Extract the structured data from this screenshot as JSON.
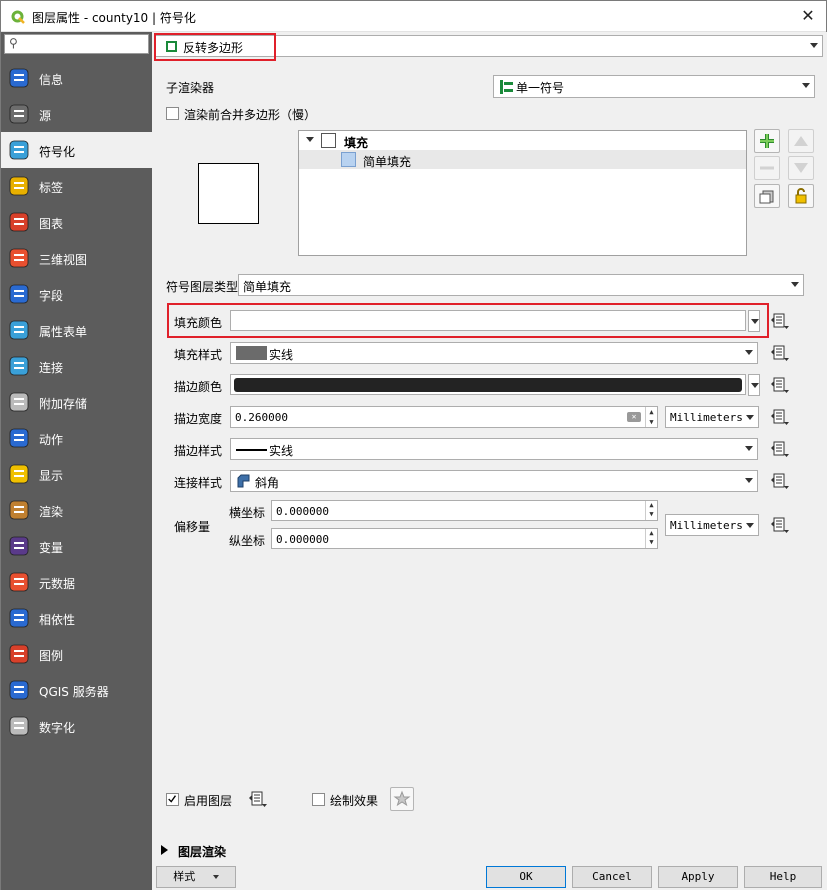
{
  "window": {
    "title": "图层属性 - county10 | 符号化",
    "close_glyph": "✕"
  },
  "sidebar": {
    "search_placeholder": "",
    "items": [
      {
        "label": "信息",
        "icon": "info-icon"
      },
      {
        "label": "源",
        "icon": "source-icon"
      },
      {
        "label": "符号化",
        "icon": "symbology-icon",
        "selected": true
      },
      {
        "label": "标签",
        "icon": "labels-icon"
      },
      {
        "label": "图表",
        "icon": "diagrams-icon"
      },
      {
        "label": "三维视图",
        "icon": "3d-view-icon"
      },
      {
        "label": "字段",
        "icon": "fields-icon"
      },
      {
        "label": "属性表单",
        "icon": "attributes-form-icon"
      },
      {
        "label": "连接",
        "icon": "joins-icon"
      },
      {
        "label": "附加存储",
        "icon": "auxiliary-storage-icon"
      },
      {
        "label": "动作",
        "icon": "actions-icon"
      },
      {
        "label": "显示",
        "icon": "display-icon"
      },
      {
        "label": "渲染",
        "icon": "rendering-icon"
      },
      {
        "label": "变量",
        "icon": "variables-icon"
      },
      {
        "label": "元数据",
        "icon": "metadata-icon"
      },
      {
        "label": "相依性",
        "icon": "dependencies-icon"
      },
      {
        "label": "图例",
        "icon": "legend-icon"
      },
      {
        "label": "QGIS 服务器",
        "icon": "qgis-server-icon"
      },
      {
        "label": "数字化",
        "icon": "digitizing-icon"
      }
    ]
  },
  "renderer": {
    "selected": "反转多边形"
  },
  "sub_renderer": {
    "label": "子渲染器",
    "selected": "单一符号"
  },
  "merge_checkbox": {
    "label": "渲染前合并多边形（慢）",
    "checked": false
  },
  "symbol_tree": {
    "root": "填充",
    "child": "简单填充"
  },
  "symbol_layer_type": {
    "label": "符号图层类型",
    "selected": "简单填充"
  },
  "properties": {
    "fill_color": {
      "label": "填充颜色",
      "color": "#ffffff"
    },
    "fill_style": {
      "label": "填充样式",
      "value": "实线",
      "swatch": "#6b6b6b"
    },
    "stroke_color": {
      "label": "描边颜色",
      "color": "#232323"
    },
    "stroke_width": {
      "label": "描边宽度",
      "value": "0.260000",
      "unit": "Millimeters"
    },
    "stroke_style": {
      "label": "描边样式",
      "value": "实线"
    },
    "join_style": {
      "label": "连接样式",
      "value": "斜角"
    },
    "offset": {
      "label": "偏移量",
      "x_label": "横坐标",
      "x_value": "0.000000",
      "y_label": "纵坐标",
      "y_value": "0.000000",
      "unit": "Millimeters"
    }
  },
  "enable_layer": {
    "label": "启用图层",
    "checked": true
  },
  "draw_effects": {
    "label": "绘制效果",
    "checked": false
  },
  "layer_rendering": {
    "label": "图层渲染"
  },
  "footer": {
    "style": "样式",
    "ok": "OK",
    "cancel": "Cancel",
    "apply": "Apply",
    "help": "Help"
  },
  "colors": {
    "highlight_red": "#e0202a",
    "sidebar_bg": "#5c5c5c",
    "renderer_green": "#1a8a3a"
  }
}
